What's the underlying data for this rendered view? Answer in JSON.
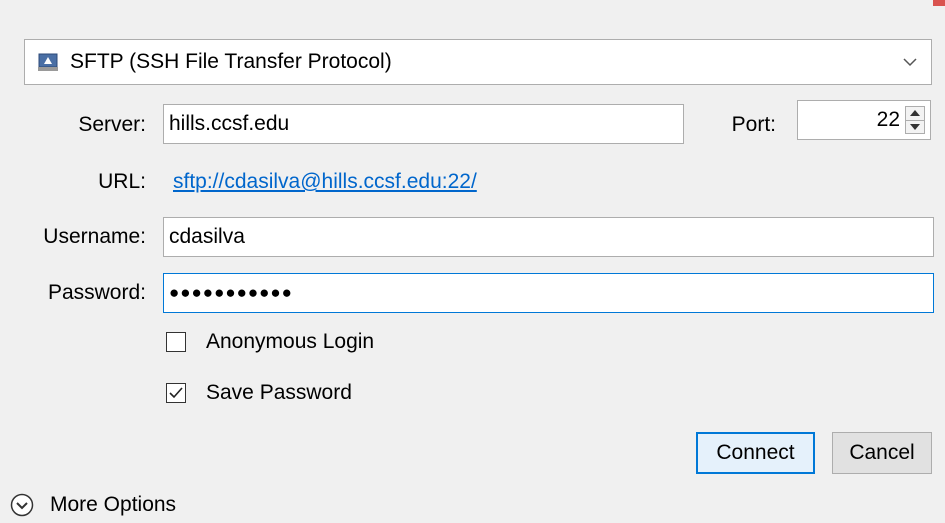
{
  "protocol": {
    "selected": "SFTP (SSH File Transfer Protocol)"
  },
  "server": {
    "label": "Server:",
    "value": "hills.ccsf.edu"
  },
  "port": {
    "label": "Port:",
    "value": "22"
  },
  "url": {
    "label": "URL:",
    "link": "sftp://cdasilva@hills.ccsf.edu:22/"
  },
  "username": {
    "label": "Username:",
    "value": "cdasilva"
  },
  "password": {
    "label": "Password:",
    "masked_value": "●●●●●●●●●●●"
  },
  "options": {
    "anonymous_login": {
      "label": "Anonymous Login",
      "checked": false
    },
    "save_password": {
      "label": "Save Password",
      "checked": true
    }
  },
  "buttons": {
    "connect": "Connect",
    "cancel": "Cancel"
  },
  "more_options": {
    "label": "More Options"
  },
  "colors": {
    "background": "#f0f0f0",
    "focus_border": "#0078d7",
    "link": "#0066cc",
    "corner_accent": "#d9534f"
  },
  "icons": {
    "protocol": "drive-icon",
    "dropdown": "chevron-down-icon",
    "more": "chevron-circle-down-icon",
    "check": "checkmark-icon"
  }
}
